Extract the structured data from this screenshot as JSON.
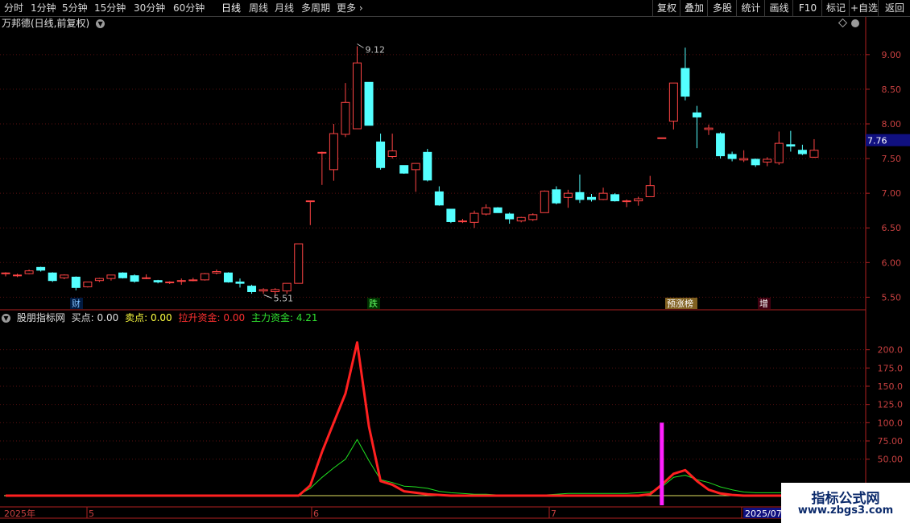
{
  "toolbar": {
    "timeframes": [
      "分时",
      "1分钟",
      "5分钟",
      "15分钟",
      "30分钟",
      "60分钟",
      "日线",
      "周线",
      "月线",
      "多周期",
      "更多"
    ],
    "active_timeframe": "日线",
    "right_buttons": [
      "复权",
      "叠加",
      "多股",
      "统计",
      "画线",
      "F10",
      "标记",
      "+自选",
      "返回"
    ]
  },
  "stock": {
    "title": "万邦德(日线,前复权)"
  },
  "price_axis": {
    "ticks": [
      "9.00",
      "8.50",
      "8.00",
      "7.50",
      "7.00",
      "6.50",
      "6.00",
      "5.50"
    ],
    "current": "7.76"
  },
  "price_annotations": {
    "high": "9.12",
    "low": "5.51"
  },
  "event_labels": [
    "财",
    "跌",
    "预涨榜",
    "增"
  ],
  "indicator": {
    "name": "股朋指标网",
    "buy_label": "买点:",
    "buy_value": "0.00",
    "sell_label": "卖点:",
    "sell_value": "0.00",
    "lift_label": "拉升资金:",
    "lift_value": "0.00",
    "main_label": "主力资金:",
    "main_value": "4.21",
    "ticks": [
      "200.0",
      "175.0",
      "150.0",
      "125.0",
      "100.0",
      "75.00",
      "50.00"
    ]
  },
  "date_axis": {
    "labels": [
      "2025年",
      "5",
      "6",
      "7",
      "2025/07"
    ]
  },
  "watermark": {
    "title": "指标公式网",
    "url": "www.zbgs3.com"
  },
  "colors": {
    "up": "#ff4444",
    "down": "#54ffff",
    "lift": "#ff2020",
    "main": "#20e020",
    "signal": "#ff20ff",
    "axis": "#b02020"
  },
  "chart_data": {
    "type": "candlestick",
    "ylim": [
      5.4,
      9.3
    ],
    "candles": [
      [
        5.84,
        5.86,
        5.8,
        5.85
      ],
      [
        5.81,
        5.84,
        5.79,
        5.82
      ],
      [
        5.84,
        5.9,
        5.83,
        5.88
      ],
      [
        5.93,
        5.94,
        5.87,
        5.89
      ],
      [
        5.85,
        5.86,
        5.72,
        5.74
      ],
      [
        5.78,
        5.83,
        5.76,
        5.82
      ],
      [
        5.79,
        5.8,
        5.6,
        5.64
      ],
      [
        5.65,
        5.72,
        5.64,
        5.72
      ],
      [
        5.74,
        5.78,
        5.72,
        5.77
      ],
      [
        5.77,
        5.82,
        5.74,
        5.82
      ],
      [
        5.85,
        5.86,
        5.77,
        5.78
      ],
      [
        5.81,
        5.83,
        5.71,
        5.73
      ],
      [
        5.78,
        5.83,
        5.76,
        5.78
      ],
      [
        5.74,
        5.75,
        5.7,
        5.72
      ],
      [
        5.71,
        5.73,
        5.69,
        5.72
      ],
      [
        5.74,
        5.77,
        5.68,
        5.74
      ],
      [
        5.75,
        5.78,
        5.73,
        5.75
      ],
      [
        5.75,
        5.85,
        5.74,
        5.84
      ],
      [
        5.85,
        5.9,
        5.83,
        5.87
      ],
      [
        5.85,
        5.86,
        5.71,
        5.72
      ],
      [
        5.72,
        5.77,
        5.64,
        5.7
      ],
      [
        5.66,
        5.68,
        5.55,
        5.58
      ],
      [
        5.59,
        5.63,
        5.55,
        5.61
      ],
      [
        5.58,
        5.63,
        5.51,
        5.61
      ],
      [
        5.59,
        5.7,
        5.55,
        5.7
      ],
      [
        5.7,
        6.27,
        5.7,
        6.27
      ],
      [
        6.89,
        6.89,
        6.54,
        6.89
      ],
      [
        7.58,
        7.6,
        7.12,
        7.59
      ],
      [
        7.34,
        8.0,
        7.18,
        7.86
      ],
      [
        7.85,
        8.59,
        7.81,
        8.31
      ],
      [
        7.93,
        9.12,
        7.93,
        8.88
      ],
      [
        8.6,
        8.6,
        7.98,
        7.98
      ],
      [
        7.74,
        7.86,
        7.34,
        7.37
      ],
      [
        7.53,
        7.86,
        7.5,
        7.61
      ],
      [
        7.4,
        7.4,
        7.28,
        7.29
      ],
      [
        7.34,
        7.43,
        7.02,
        7.43
      ],
      [
        7.59,
        7.64,
        7.17,
        7.19
      ],
      [
        7.02,
        7.1,
        6.82,
        6.83
      ],
      [
        6.77,
        6.77,
        6.57,
        6.59
      ],
      [
        6.6,
        6.63,
        6.57,
        6.6
      ],
      [
        6.58,
        6.75,
        6.5,
        6.71
      ],
      [
        6.7,
        6.84,
        6.68,
        6.79
      ],
      [
        6.79,
        6.8,
        6.72,
        6.72
      ],
      [
        6.7,
        6.72,
        6.56,
        6.63
      ],
      [
        6.6,
        6.66,
        6.58,
        6.65
      ],
      [
        6.62,
        6.71,
        6.6,
        6.69
      ],
      [
        6.72,
        7.04,
        6.72,
        7.03
      ],
      [
        7.05,
        7.1,
        6.84,
        6.86
      ],
      [
        6.94,
        7.05,
        6.79,
        7.0
      ],
      [
        7.01,
        7.27,
        6.86,
        6.91
      ],
      [
        6.94,
        6.99,
        6.88,
        6.91
      ],
      [
        6.91,
        7.08,
        6.9,
        7.0
      ],
      [
        6.98,
        7.0,
        6.88,
        6.89
      ],
      [
        6.88,
        6.91,
        6.8,
        6.89
      ],
      [
        6.89,
        6.95,
        6.82,
        6.92
      ],
      [
        6.95,
        7.25,
        6.95,
        7.11
      ],
      [
        7.8,
        7.8,
        7.8,
        7.8
      ],
      [
        8.04,
        8.5,
        7.92,
        8.59
      ],
      [
        8.8,
        9.1,
        8.34,
        8.4
      ],
      [
        8.16,
        8.26,
        7.65,
        8.1
      ],
      [
        7.92,
        7.99,
        7.84,
        7.94
      ],
      [
        7.86,
        7.88,
        7.5,
        7.54
      ],
      [
        7.56,
        7.6,
        7.46,
        7.5
      ],
      [
        7.48,
        7.62,
        7.45,
        7.5
      ],
      [
        7.49,
        7.5,
        7.38,
        7.41
      ],
      [
        7.45,
        7.52,
        7.39,
        7.49
      ],
      [
        7.44,
        7.89,
        7.41,
        7.72
      ],
      [
        7.7,
        7.9,
        7.6,
        7.68
      ],
      [
        7.62,
        7.7,
        7.55,
        7.57
      ],
      [
        7.52,
        7.78,
        7.51,
        7.62
      ]
    ],
    "lift_series": [
      0,
      0,
      0,
      0,
      0,
      0,
      0,
      0,
      0,
      0,
      0,
      0,
      0,
      0,
      0,
      0,
      0,
      0,
      0,
      0,
      0,
      0,
      0,
      0,
      0,
      0,
      14,
      60,
      100,
      140,
      210,
      95,
      20,
      15,
      6,
      4,
      2,
      1,
      0,
      0,
      0,
      0,
      0,
      0,
      0,
      0,
      0,
      0,
      0,
      0,
      0,
      0,
      0,
      0,
      0,
      2,
      15,
      30,
      35,
      20,
      8,
      3,
      1,
      0,
      0,
      0,
      0,
      0,
      0,
      0,
      0
    ],
    "main_series": [
      0,
      0,
      0,
      0,
      0,
      0,
      0,
      0,
      0,
      0,
      0,
      0,
      0,
      0,
      0,
      0,
      0,
      0,
      0,
      0,
      0,
      0,
      0,
      0,
      0,
      1,
      10,
      25,
      38,
      50,
      77,
      48,
      22,
      18,
      13,
      12,
      10,
      6,
      4,
      3,
      2,
      2,
      1,
      1,
      1,
      1,
      1,
      2,
      3,
      3,
      3,
      3,
      3,
      3,
      4,
      5,
      12,
      25,
      28,
      22,
      18,
      12,
      8,
      5,
      4,
      4,
      4,
      5,
      6,
      7,
      8
    ],
    "signal_bar_index": 56,
    "signal_bar_value": 100,
    "ind_ylim": [
      0,
      225
    ]
  }
}
